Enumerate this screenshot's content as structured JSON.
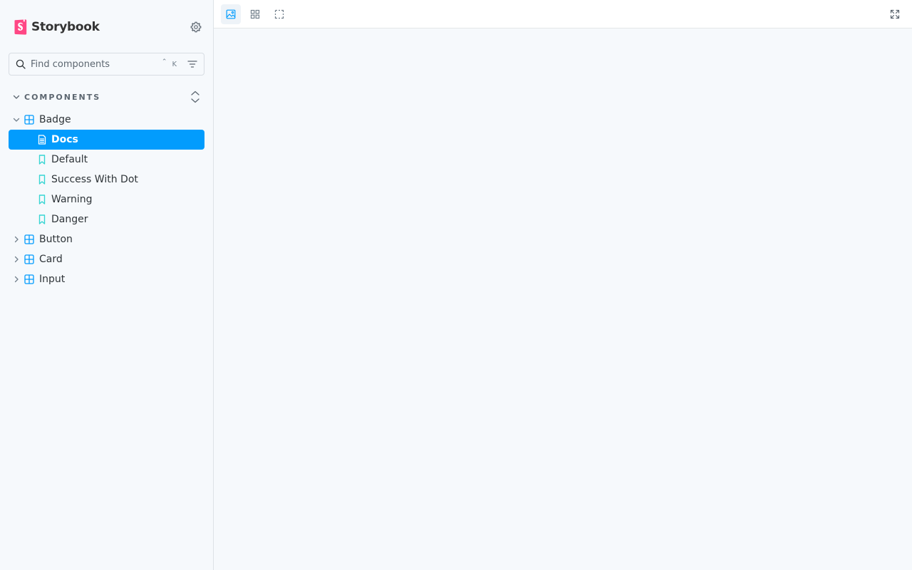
{
  "app": {
    "brand_name": "Storybook",
    "accent_color": "#029cfd",
    "logo_color": "#ff4785"
  },
  "search": {
    "placeholder": "Find components",
    "shortcut_modifier": "⌃",
    "shortcut_key": "K"
  },
  "section": {
    "title": "COMPONENTS"
  },
  "tree": {
    "badge": {
      "label": "Badge",
      "expanded": true,
      "stories": {
        "docs": "Docs",
        "default": "Default",
        "success_with_dot": "Success With Dot",
        "warning": "Warning",
        "danger": "Danger"
      },
      "selected": "Docs"
    },
    "button": {
      "label": "Button",
      "expanded": false
    },
    "card": {
      "label": "Card",
      "expanded": false
    },
    "input": {
      "label": "Input",
      "expanded": false
    }
  },
  "toolbar": {
    "icons": [
      "image-icon",
      "grid-icon",
      "outline-icon",
      "fullscreen-icon"
    ],
    "active": "image-icon"
  }
}
